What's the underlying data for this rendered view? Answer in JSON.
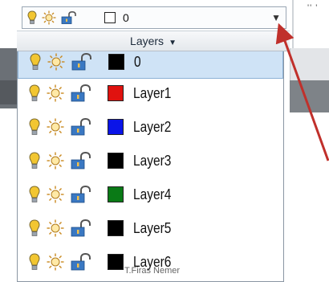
{
  "combo": {
    "current_layer": "0",
    "current_color": "#ffffff"
  },
  "panel": {
    "title": "Layers"
  },
  "layers": [
    {
      "name": "0",
      "color": "#000000"
    },
    {
      "name": "Layer1",
      "color": "#e0120f"
    },
    {
      "name": "Layer2",
      "color": "#0a14e8"
    },
    {
      "name": "Layer3",
      "color": "#000000"
    },
    {
      "name": "Layer4",
      "color": "#0a7a16"
    },
    {
      "name": "Layer5",
      "color": "#000000"
    },
    {
      "name": "Layer6",
      "color": "#000000"
    }
  ],
  "top_right_text": "'' '",
  "watermark": "T.Firas Nemer",
  "accent": {
    "arrow": "#c0302b",
    "selection": "#cfe3f6",
    "bulb": "#f2c631",
    "sun": "#e8a82a",
    "lock": "#3a78c2"
  }
}
